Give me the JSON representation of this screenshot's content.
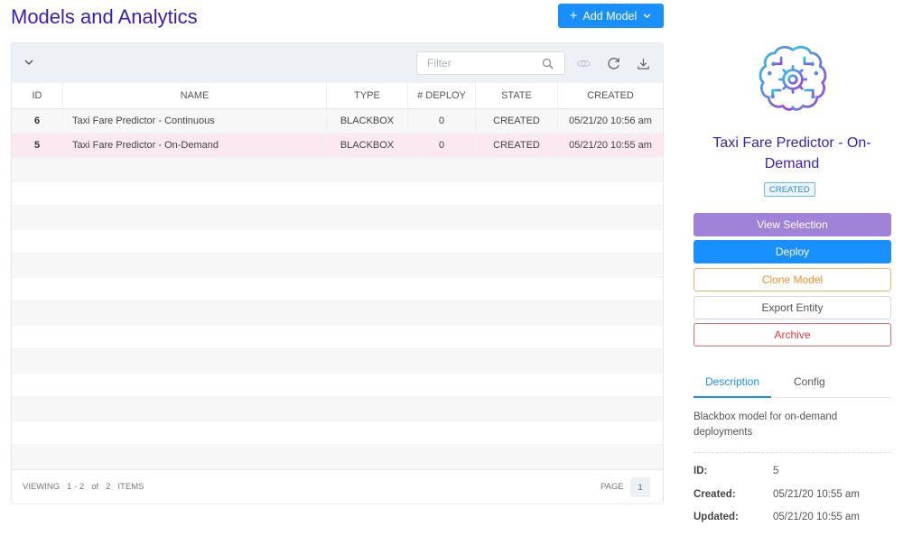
{
  "page": {
    "title": "Models and Analytics"
  },
  "toolbar": {
    "add_model_label": "Add Model",
    "filter_placeholder": "Filter"
  },
  "table": {
    "columns": {
      "id": "ID",
      "name": "NAME",
      "type": "TYPE",
      "deploy": "# DEPLOY",
      "state": "STATE",
      "created": "CREATED"
    },
    "rows": [
      {
        "id": "6",
        "name": "Taxi Fare Predictor - Continuous",
        "type": "BLACKBOX",
        "deploy": "0",
        "state": "CREATED",
        "created": "05/21/20 10:56 am"
      },
      {
        "id": "5",
        "name": "Taxi Fare Predictor - On-Demand",
        "type": "BLACKBOX",
        "deploy": "0",
        "state": "CREATED",
        "created": "05/21/20 10:55 am"
      }
    ]
  },
  "footer": {
    "viewing": "VIEWING",
    "range": "1 - 2",
    "of": "of",
    "total": "2",
    "items": "ITEMS",
    "page_label": "PAGE",
    "page_number": "1"
  },
  "detail": {
    "title": "Taxi Fare Predictor - On-Demand",
    "state": "CREATED",
    "actions": {
      "view": "View Selection",
      "deploy": "Deploy",
      "clone": "Clone Model",
      "export": "Export Entity",
      "archive": "Archive"
    },
    "tabs": {
      "description": "Description",
      "config": "Config"
    },
    "description": "Blackbox model for on-demand deployments",
    "meta": {
      "id_label": "ID:",
      "id": "5",
      "created_label": "Created:",
      "created": "05/21/20 10:55 am",
      "updated_label": "Updated:",
      "updated": "05/21/20 10:55 am"
    }
  },
  "colors": {
    "primary": "#1890ff",
    "title": "#3a1db5",
    "selected_row": "#fbe8f1",
    "view_button": "#a182d9",
    "clone": "#f0922b",
    "archive": "#e03b3b"
  },
  "icons": {
    "add": "plus-icon",
    "dropdown": "chevron-down-icon",
    "collapse": "chevron-down-icon",
    "search": "search-icon",
    "view": "eye-icon",
    "refresh": "refresh-icon",
    "download": "download-icon",
    "model": "brain-gear-icon"
  }
}
